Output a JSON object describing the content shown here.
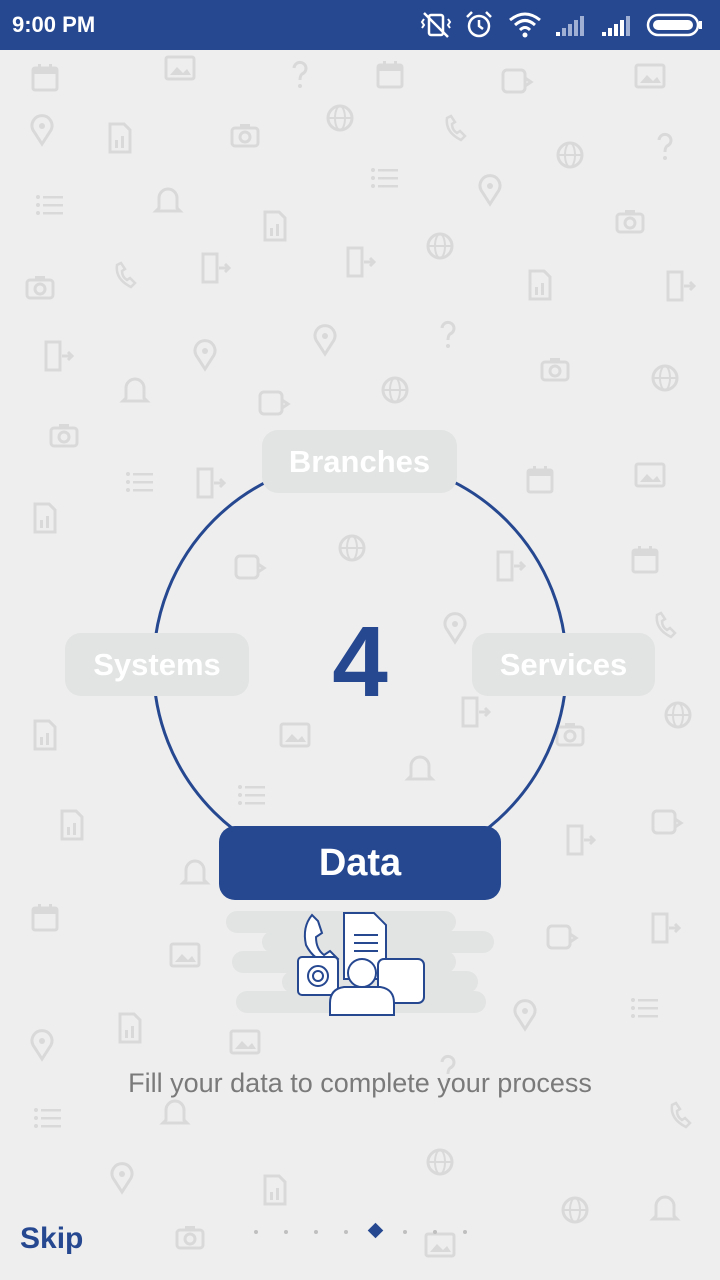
{
  "status_bar": {
    "time": "9:00 PM",
    "background": "#264891",
    "icons": [
      "vibrate-off-icon",
      "alarm-icon",
      "wifi-icon",
      "signal-weak-icon",
      "signal-strong-icon",
      "battery-icon"
    ]
  },
  "diagram": {
    "center_number": "4",
    "nodes": {
      "top": "Branches",
      "left": "Systems",
      "right": "Services",
      "bottom": "Data"
    }
  },
  "caption": "Fill your data to complete your process",
  "footer": {
    "skip_label": "Skip",
    "page_count": 8,
    "active_page_index": 4
  },
  "colors": {
    "accent": "#264891",
    "background": "#eeeeee",
    "pill_inactive": "#e2e3e3",
    "caption": "#7a7a7a"
  }
}
